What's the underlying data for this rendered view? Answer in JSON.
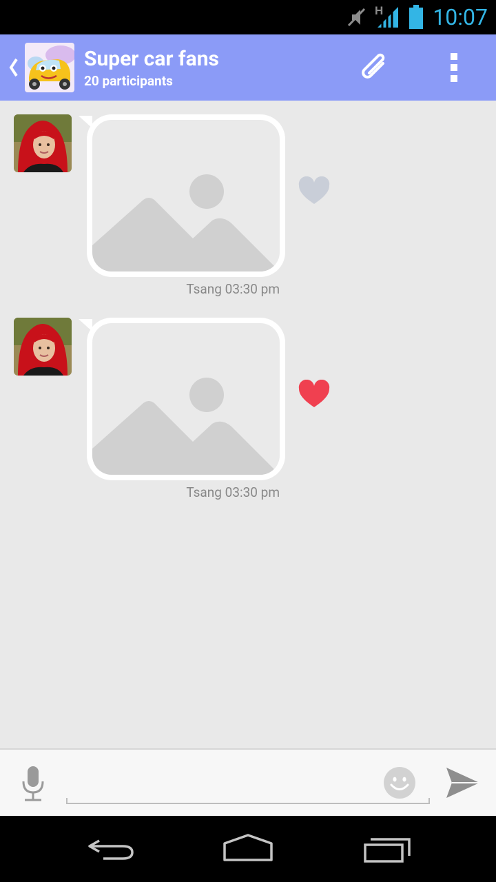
{
  "status_bar": {
    "time": "10:07",
    "network_type": "H",
    "icons": [
      "mute-icon",
      "signal-icon",
      "battery-icon"
    ]
  },
  "action_bar": {
    "title": "Super car fans",
    "subtitle": "20 participants",
    "icons": [
      "back-chevron-icon",
      "group-avatar",
      "attach-icon",
      "overflow-menu-icon"
    ]
  },
  "messages": [
    {
      "sender": "Tsang",
      "time": "03:30 pm",
      "meta": "Tsang 03:30 pm",
      "type": "image",
      "liked": false
    },
    {
      "sender": "Tsang",
      "time": "03:30 pm",
      "meta": "Tsang 03:30 pm",
      "type": "image",
      "liked": true
    }
  ],
  "compose": {
    "value": "",
    "placeholder": "",
    "icons": [
      "mic-icon",
      "smiley-icon",
      "send-icon"
    ]
  },
  "nav_bar": {
    "icons": [
      "back-icon",
      "home-icon",
      "recent-apps-icon"
    ]
  },
  "colors": {
    "action_bar": "#8b9bf7",
    "status_time": "#33b5e5",
    "background": "#e9e9e9",
    "heart_liked": "#f04050",
    "heart_unliked": "#c9ced8",
    "bubble_border": "#ffffff",
    "placeholder_image": "#d0d0d0"
  }
}
